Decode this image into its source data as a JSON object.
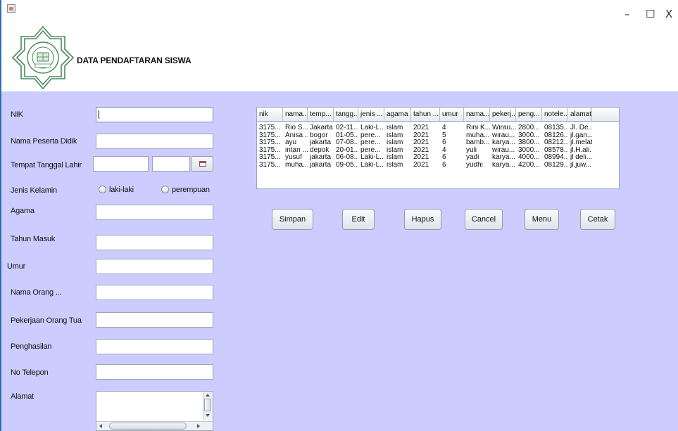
{
  "window": {
    "minimize": "–",
    "maximize": "☐",
    "close": "X"
  },
  "header": {
    "title": "DATA PENDAFTARAN SISWA"
  },
  "form": {
    "labels": {
      "nik": "NIK",
      "nama": "Nama Peserta Didik",
      "ttl": "Tempat Tanggal Lahir",
      "jk": "Jenis Kelamin",
      "agama": "Agama",
      "tahun": "Tahun Masuk",
      "umur": "Umur",
      "ortu": "Nama Orang ...",
      "pekerjaan": "Pekerjaan Orang Tua",
      "penghasilan": "Penghasilan",
      "telepon": "No Telepon",
      "alamat": "Alamat"
    },
    "radio": {
      "laki": "laki-laki",
      "perempuan": "perempuan"
    }
  },
  "buttons": {
    "simpan": "Simpan",
    "edit": "Edit",
    "hapus": "Hapus",
    "cancel": "Cancel",
    "menu": "Menu",
    "cetak": "Cetak"
  },
  "table": {
    "columns": [
      "nik",
      "nama...",
      "temp...",
      "tangg...",
      "jenis ...",
      "agama",
      "tahun ...",
      "umur",
      "nama...",
      "pekerj...",
      "peng...",
      "notele...",
      "alamat"
    ],
    "rows": [
      [
        "3175...",
        "Rio S...",
        "Jakarta",
        "02-11...",
        "Laki-L...",
        "islam",
        "2021",
        "4",
        "Rini K...",
        "Wirau...",
        "2800...",
        "08135...",
        "Jl. De..."
      ],
      [
        "3175...",
        "Anisa ...",
        "bogor",
        "01-05...",
        "pere...",
        "islam",
        "2021",
        "5",
        "muha...",
        "wirau...",
        "3000...",
        "08126...",
        "jl.gan..."
      ],
      [
        "3175...",
        "ayu",
        "jakarta",
        "07-08...",
        "pere...",
        "islam",
        "2021",
        "6",
        "bamb...",
        "karya...",
        "3800...",
        "08212...",
        "jl.melati"
      ],
      [
        "3175...",
        "intan ...",
        "depok",
        "20-01...",
        "pere...",
        "islam",
        "2021",
        "4",
        "yuli",
        "wirau...",
        "3000...",
        "08578...",
        "jl.H.ali..."
      ],
      [
        "3175...",
        "yusuf",
        "jakarta",
        "06-08...",
        "Laki-L...",
        "islam",
        "2021",
        "6",
        "yadi",
        "karya...",
        "4000...",
        "08994...",
        "jl deli..."
      ],
      [
        "3175...",
        "muha...",
        "jakarta",
        "09-05...",
        "Laki-L...",
        "islam",
        "2021",
        "6",
        "yudhi",
        "karya...",
        "4200...",
        "08129...",
        "jl.juw..."
      ]
    ]
  },
  "colors": {
    "panel": "#ccccff",
    "logo": "#4a8a5a"
  }
}
